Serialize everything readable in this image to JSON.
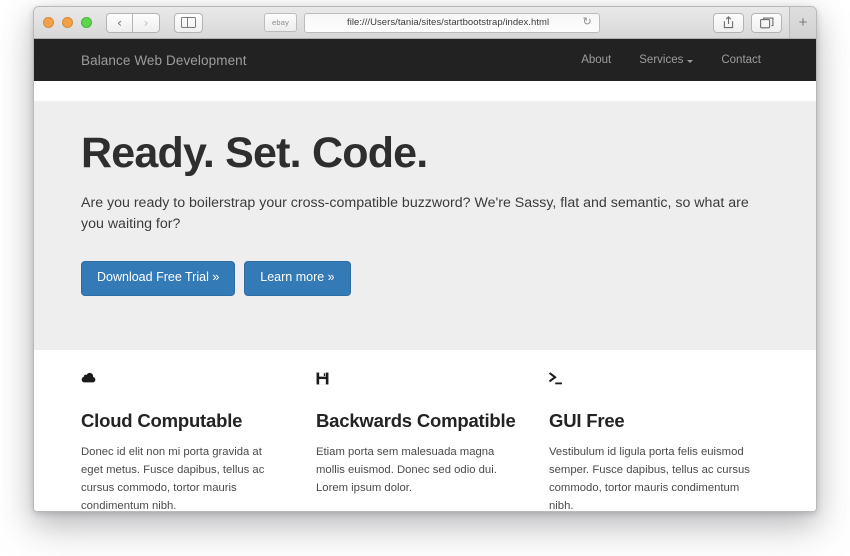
{
  "browser": {
    "traffic_lights": [
      "close",
      "minimize",
      "zoom"
    ],
    "nav_back_label": "‹",
    "nav_forward_label": "›",
    "bookmark_label": "ebay",
    "url": "file:///Users/tania/sites/startbootstrap/index.html",
    "reload_glyph": "↻",
    "new_tab_label": "+"
  },
  "site": {
    "navbar": {
      "brand": "Balance Web Development",
      "links": [
        {
          "label": "About",
          "dropdown": false
        },
        {
          "label": "Services",
          "dropdown": true
        },
        {
          "label": "Contact",
          "dropdown": false
        }
      ]
    },
    "hero": {
      "title": "Ready. Set. Code.",
      "lead": "Are you ready to boilerstrap your cross-compatible buzzword? We're Sassy, flat and semantic, so what are you waiting for?",
      "buttons": [
        {
          "label": "Download Free Trial »"
        },
        {
          "label": "Learn more »"
        }
      ],
      "background": "#eeeeee"
    },
    "features": [
      {
        "icon": "cloud-icon",
        "title": "Cloud Computable",
        "body": "Donec id elit non mi porta gravida at eget metus. Fusce dapibus, tellus ac cursus commodo, tortor mauris condimentum nibh."
      },
      {
        "icon": "floppy-disk-icon",
        "title": "Backwards Compatible",
        "body": "Etiam porta sem malesuada magna mollis euismod. Donec sed odio dui. Lorem ipsum dolor."
      },
      {
        "icon": "terminal-icon",
        "title": "GUI Free",
        "body": "Vestibulum id ligula porta felis euismod semper. Fusce dapibus, tellus ac cursus commodo, tortor mauris condimentum nibh."
      }
    ],
    "colors": {
      "navbar_bg": "#222222",
      "navbar_text": "#9d9d9d",
      "primary_button": "#337ab7",
      "primary_button_border": "#2e6da4",
      "jumbotron_bg": "#eeeeee",
      "heading": "#2e2e2e"
    }
  }
}
